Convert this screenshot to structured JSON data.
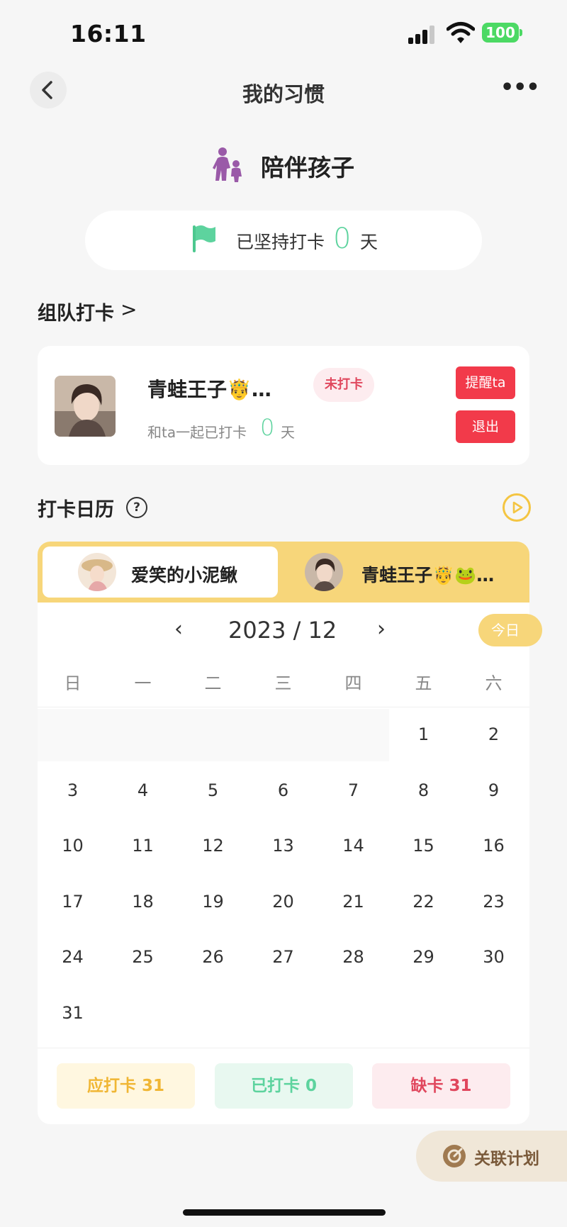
{
  "status_bar": {
    "time": "16:11",
    "battery": "100"
  },
  "nav": {
    "title": "我的习惯",
    "more": "•••"
  },
  "habit": {
    "name": "陪伴孩子"
  },
  "streak": {
    "prefix": "已坚持打卡",
    "days": "0",
    "unit": "天"
  },
  "team": {
    "title": "组队打卡",
    "chevron": ">",
    "member": {
      "name": "青蛙王子🤴…",
      "status": "未打卡",
      "together_prefix": "和ta一起已打卡",
      "together_days": "0",
      "together_unit": "天",
      "remind_label": "提醒ta",
      "quit_label": "退出"
    }
  },
  "calendar": {
    "title": "打卡日历",
    "help": "?",
    "users": [
      {
        "name": "爱笑的小泥鳅",
        "active": true
      },
      {
        "name": "青蛙王子🤴🐸…",
        "active": false
      }
    ],
    "prev": "‹",
    "next": "›",
    "month_label": "2023 / 12",
    "today_label": "今日",
    "weekdays": [
      "日",
      "一",
      "二",
      "三",
      "四",
      "五",
      "六"
    ],
    "days": [
      "1",
      "2",
      "3",
      "4",
      "5",
      "6",
      "7",
      "8",
      "9",
      "10",
      "11",
      "12",
      "13",
      "14",
      "15",
      "16",
      "17",
      "18",
      "19",
      "20",
      "21",
      "22",
      "23",
      "24",
      "25",
      "26",
      "27",
      "28",
      "29",
      "30",
      "31"
    ],
    "first_weekday_index": 5,
    "stats": {
      "should": "应打卡 31",
      "done": "已打卡 0",
      "missed": "缺卡 31"
    }
  },
  "plan_button": {
    "label": "关联计划"
  },
  "colors": {
    "accent_green": "#5dd39e",
    "accent_yellow": "#f7d67a",
    "danger_red": "#f23a4a",
    "habit_purple": "#9a5aa8"
  }
}
